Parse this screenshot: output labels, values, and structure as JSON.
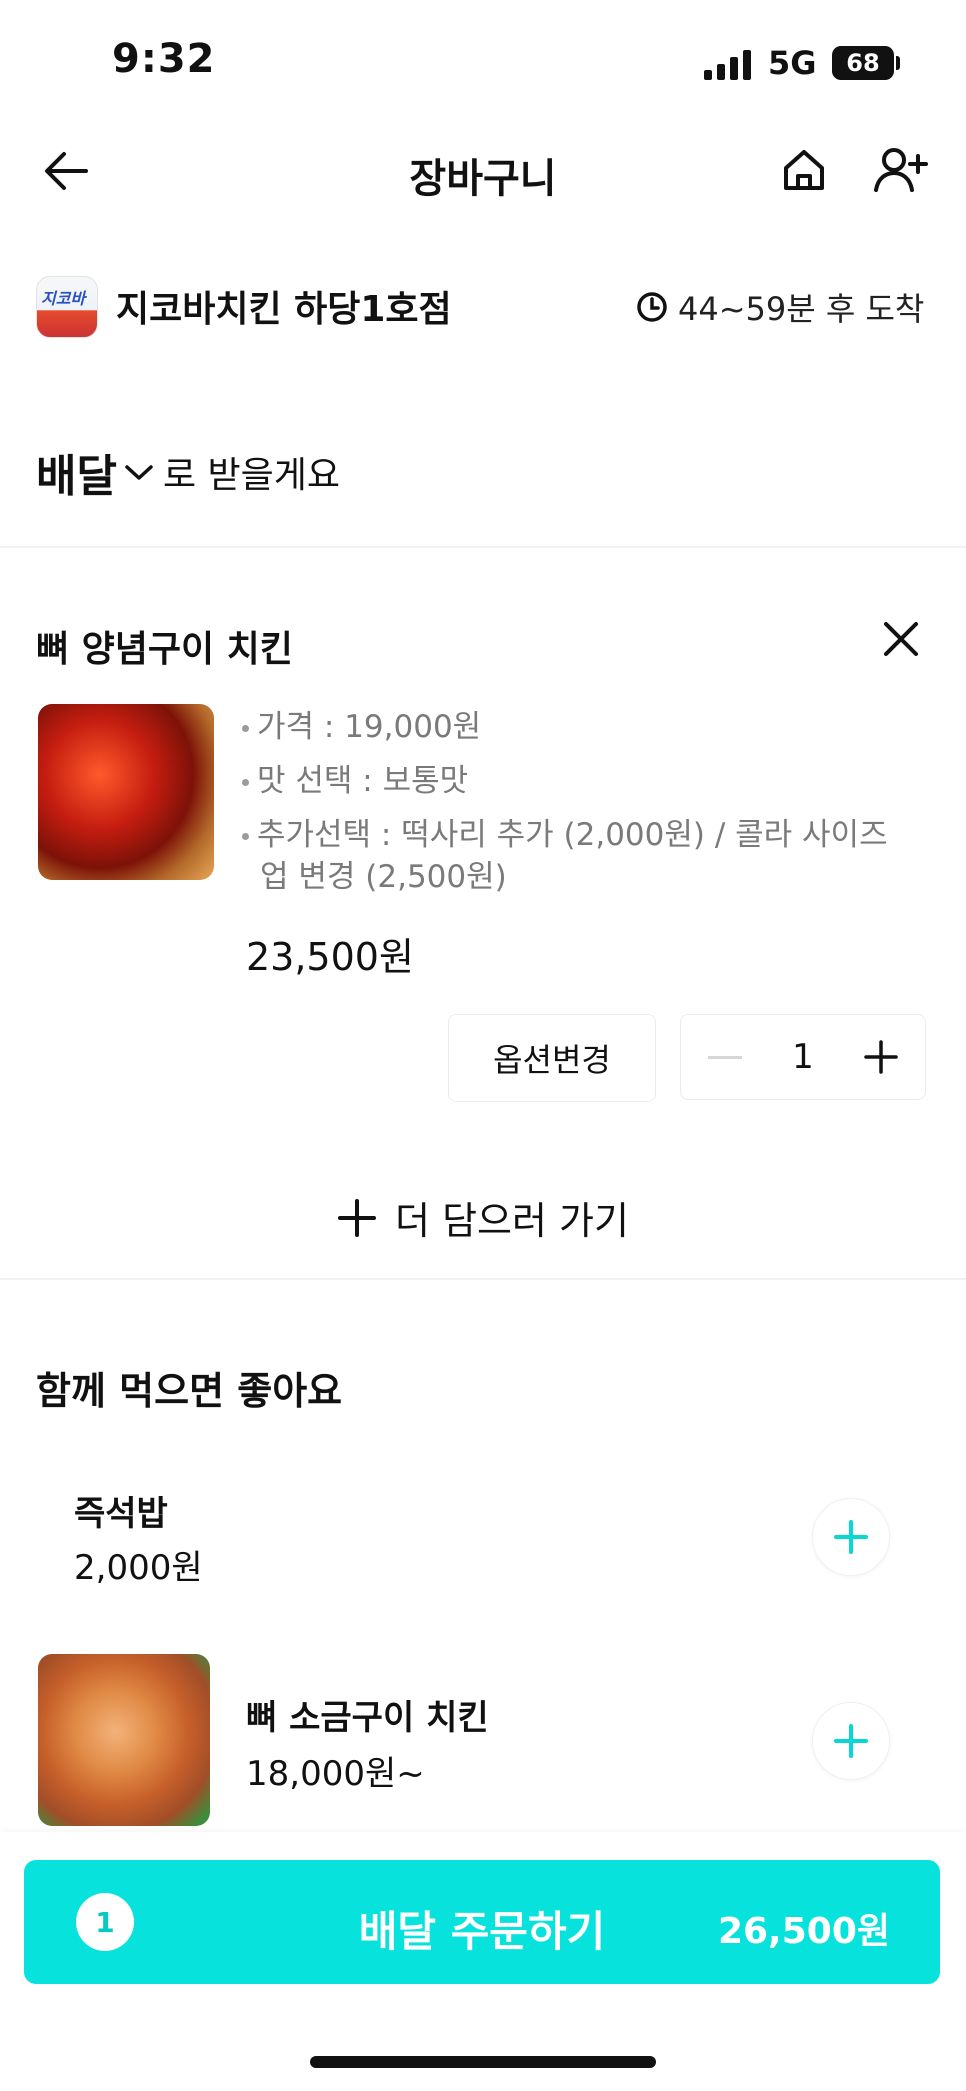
{
  "status_bar": {
    "time": "9:32",
    "network": "5G",
    "battery": "68"
  },
  "header": {
    "title": "장바구니",
    "back_icon": "arrow-left-icon",
    "home_icon": "home-icon",
    "share_icon": "add-person-icon"
  },
  "store": {
    "name": "지코바치킨 하당1호점",
    "logo_text": "지코바",
    "eta": "44~59분 후 도착",
    "eta_icon": "clock-icon"
  },
  "delivery": {
    "mode": "배달",
    "suffix": "로 받을게요",
    "chevron_icon": "chevron-down-icon"
  },
  "cart_item": {
    "name": "뼈 양념구이 치킨",
    "details": [
      "가격 : 19,000원",
      "맛 선택 : 보통맛",
      "추가선택 : 떡사리 추가 (2,000원) / 콜라 사이즈",
      "업 변경 (2,500원)"
    ],
    "price": "23,500원",
    "option_button": "옵션변경",
    "quantity": "1"
  },
  "add_more": "더 담으러 가기",
  "recommend": {
    "title": "함께 먹으면 좋아요",
    "items": [
      {
        "name": "즉석밥",
        "price": "2,000원"
      },
      {
        "name": "뼈 소금구이 치킨",
        "price": "18,000원~"
      }
    ]
  },
  "order": {
    "count": "1",
    "label": "배달 주문하기",
    "total": "26,500원"
  },
  "colors": {
    "accent": "#07e2dc"
  }
}
